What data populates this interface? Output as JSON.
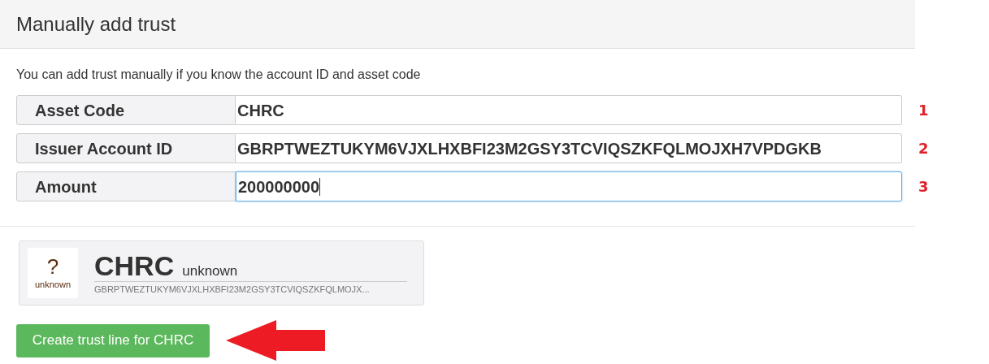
{
  "panel": {
    "title": "Manually add trust",
    "description": "You can add trust manually if you know the account ID and asset code",
    "fields": [
      {
        "label": "Asset Code",
        "value": "CHRC",
        "focused": false,
        "annotation": "1"
      },
      {
        "label": "Issuer Account ID",
        "value": "GBRPTWEZTUKYM6VJXLHXBFI23M2GSY3TCVIQSZKFQLMOJXH7VPDGKB",
        "focused": false,
        "annotation": "2"
      },
      {
        "label": "Amount",
        "value": "200000000",
        "focused": true,
        "annotation": "3"
      }
    ],
    "asset_card": {
      "icon_symbol": "?",
      "icon_label": "unknown",
      "code": "CHRC",
      "domain": "unknown",
      "issuer": "GBRPTWEZTUKYM6VJXLHXBFI23M2GSY3TCVIQSZKFQLMOJX..."
    },
    "button": "Create trust line for CHRC"
  }
}
